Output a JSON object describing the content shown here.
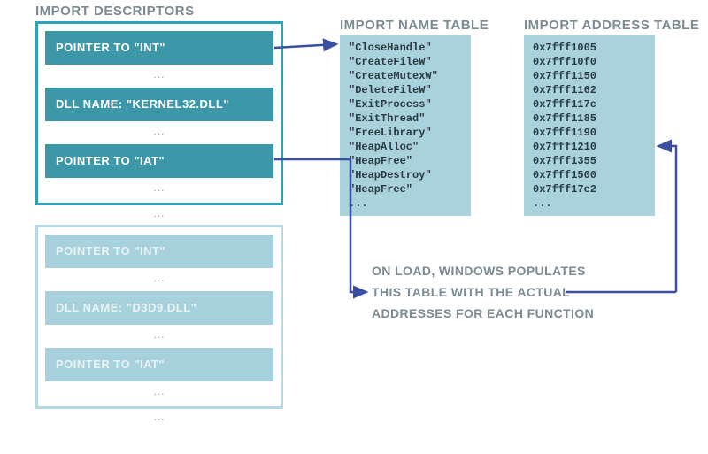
{
  "headings": {
    "descriptors": "IMPORT DESCRIPTORS",
    "int": "IMPORT NAME TABLE",
    "iat": "IMPORT ADDRESS TABLE"
  },
  "descriptor_active": {
    "pointer_int": "POINTER TO \"INT\"",
    "dll_name": "DLL NAME: \"KERNEL32.DLL\"",
    "pointer_iat": "POINTER TO \"IAT\""
  },
  "descriptor_inactive": {
    "pointer_int": "POINTER TO \"INT\"",
    "dll_name": "DLL NAME: \"D3D9.DLL\"",
    "pointer_iat": "POINTER TO \"IAT\""
  },
  "import_name_table": [
    "\"CloseHandle\"",
    "\"CreateFileW\"",
    "\"CreateMutexW\"",
    "\"DeleteFileW\"",
    "\"ExitProcess\"",
    "\"ExitThread\"",
    "\"FreeLibrary\"",
    "\"HeapAlloc\"",
    "\"HeapFree\"",
    "\"HeapDestroy\"",
    "\"HeapFree\"",
    "..."
  ],
  "import_address_table": [
    "0x7fff1005",
    "0x7fff10f0",
    "0x7fff1150",
    "0x7fff1162",
    "0x7fff117c",
    "0x7fff1185",
    "0x7fff1190",
    "0x7fff1210",
    "0x7fff1355",
    "0x7fff1500",
    "0x7fff17e2",
    "..."
  ],
  "annotation": {
    "line1": "ON LOAD, WINDOWS POPULATES",
    "line2": "THIS TABLE WITH THE ACTUAL",
    "line3": "ADDRESSES FOR EACH FUNCTION"
  },
  "ellipsis": "...",
  "colors": {
    "accent": "#3c98a8",
    "accent_light": "#a9d2dd",
    "arrow": "#3a4fa0"
  }
}
